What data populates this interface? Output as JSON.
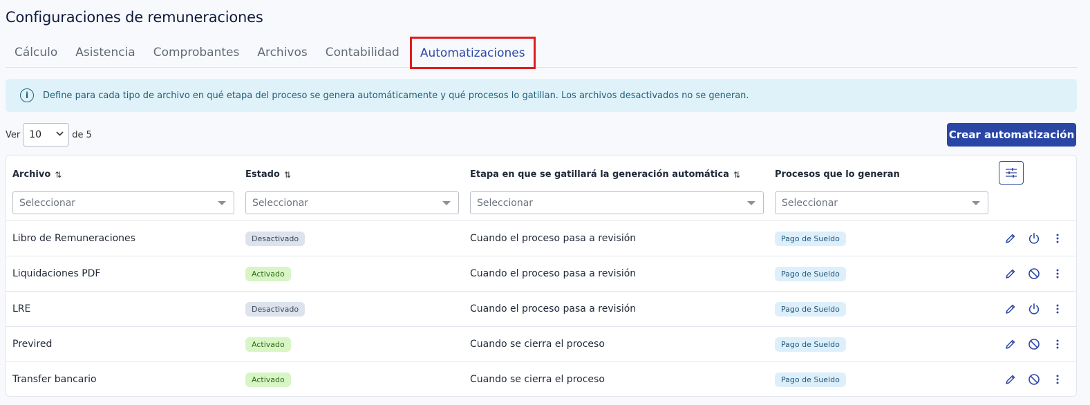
{
  "page_title": "Configuraciones de remuneraciones",
  "tabs": [
    {
      "label": "Cálculo",
      "active": false
    },
    {
      "label": "Asistencia",
      "active": false
    },
    {
      "label": "Comprobantes",
      "active": false
    },
    {
      "label": "Archivos",
      "active": false
    },
    {
      "label": "Contabilidad",
      "active": false
    },
    {
      "label": "Automatizaciones",
      "active": true
    }
  ],
  "info_banner": {
    "text": "Define para cada tipo de archivo en qué etapa del proceso se genera automáticamente y qué procesos lo gatillan. Los archivos desactivados no se generan.",
    "icon": "info-icon"
  },
  "pager": {
    "prefix": "Ver",
    "page_size": "10",
    "options": [
      "10"
    ],
    "suffix": "de 5"
  },
  "create_button_label": "Crear automatización",
  "table": {
    "columns": [
      {
        "label": "Archivo",
        "sortable": true,
        "filter_placeholder": "Seleccionar"
      },
      {
        "label": "Estado",
        "sortable": true,
        "filter_placeholder": "Seleccionar"
      },
      {
        "label": "Etapa en que se gatillará la generación automática",
        "sortable": true,
        "filter_placeholder": "Seleccionar"
      },
      {
        "label": "Procesos que lo generan",
        "sortable": false,
        "filter_placeholder": "Seleccionar"
      }
    ],
    "rows": [
      {
        "archivo": "Libro de Remuneraciones",
        "estado": "Desactivado",
        "estado_active": false,
        "etapa": "Cuando el proceso pasa a revisión",
        "proceso": "Pago de Sueldo",
        "toggle_icon": "power-icon"
      },
      {
        "archivo": "Liquidaciones PDF",
        "estado": "Activado",
        "estado_active": true,
        "etapa": "Cuando el proceso pasa a revisión",
        "proceso": "Pago de Sueldo",
        "toggle_icon": "ban-icon"
      },
      {
        "archivo": "LRE",
        "estado": "Desactivado",
        "estado_active": false,
        "etapa": "Cuando el proceso pasa a revisión",
        "proceso": "Pago de Sueldo",
        "toggle_icon": "power-icon"
      },
      {
        "archivo": "Previred",
        "estado": "Activado",
        "estado_active": true,
        "etapa": "Cuando se cierra el proceso",
        "proceso": "Pago de Sueldo",
        "toggle_icon": "ban-icon"
      },
      {
        "archivo": "Transfer bancario",
        "estado": "Activado",
        "estado_active": true,
        "etapa": "Cuando se cierra el proceso",
        "proceso": "Pago de Sueldo",
        "toggle_icon": "ban-icon"
      }
    ]
  },
  "colors": {
    "primary": "#2a46a5",
    "highlight_box": "#e21b1b",
    "banner_bg": "#dff2f9",
    "badge_on": "#d8f5c6",
    "badge_off": "#dde3ed",
    "badge_process": "#ddeffa"
  }
}
